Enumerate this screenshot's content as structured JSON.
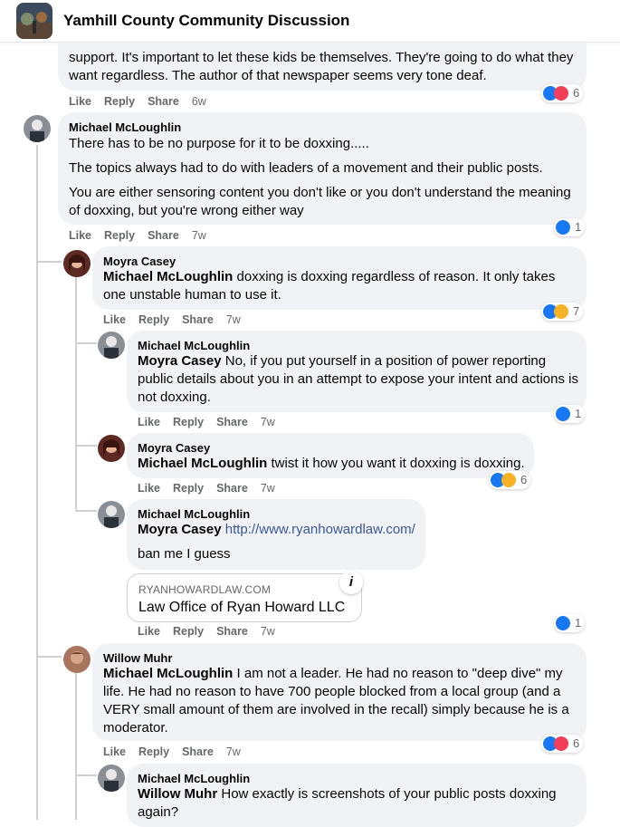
{
  "header": {
    "title": "Yamhill County Community Discussion",
    "icon": "group-photo"
  },
  "actions": {
    "like": "Like",
    "reply": "Reply",
    "share": "Share"
  },
  "comments": [
    {
      "name": "",
      "text": "support. It's important to let these kids be themselves. They're going to do what they want regardless. The author of that newspaper seems very tone deaf.",
      "time": "6w",
      "reaction_count": "6",
      "reactions": [
        "like-icon",
        "love-icon"
      ]
    },
    {
      "name": "Michael McLoughlin",
      "paragraphs": [
        "There has to be no purpose for it to be doxxing.....",
        "The topics always had to do with leaders of a movement and their public posts.",
        "You are either sensoring content you don't like or you don't understand the meaning of doxxing, but you're wrong either way"
      ],
      "time": "7w",
      "reaction_count": "1",
      "reactions": [
        "like-icon"
      ]
    },
    {
      "name": "Moyra Casey",
      "mention": "Michael McLoughlin",
      "text": " doxxing is doxxing regardless of reason. It only takes one unstable human to use it.",
      "time": "7w",
      "reaction_count": "7",
      "reactions": [
        "like-icon",
        "haha-icon"
      ]
    },
    {
      "name": "Michael McLoughlin",
      "mention": "Moyra Casey",
      "text": " No, if you put yourself in a position of power reporting public details about you in an attempt to expose your intent and actions is not doxxing.",
      "time": "7w",
      "reaction_count": "1",
      "reactions": [
        "like-icon"
      ]
    },
    {
      "name": "Moyra Casey",
      "mention": "Michael McLoughlin",
      "text": " twist it how you want it doxxing is doxxing.",
      "time": "7w",
      "reaction_count": "6",
      "reactions": [
        "like-icon",
        "haha-icon"
      ]
    },
    {
      "name": "Michael McLoughlin",
      "mention": "Moyra Casey",
      "link": "http://www.ryanhowardlaw.com/",
      "text2": "ban me I guess",
      "preview_domain": "RYANHOWARDLAW.COM",
      "preview_title": "Law Office of Ryan Howard LLC",
      "preview_info": "i",
      "time": "7w",
      "reaction_count": "1",
      "reactions": [
        "like-icon"
      ]
    },
    {
      "name": "Willow Muhr",
      "mention": "Michael McLoughlin",
      "text": " I am not a leader. He had no reason to \"deep dive\" my life. He had no reason to have 700 people blocked from a local group (and a VERY small amount of them are involved in the recall) simply because he is a moderator.",
      "time": "7w",
      "reaction_count": "6",
      "reactions": [
        "like-icon",
        "love-icon"
      ]
    },
    {
      "name": "Michael McLoughlin",
      "mention": "Willow Muhr",
      "text": " How exactly is screenshots of your public posts doxxing again?"
    }
  ]
}
